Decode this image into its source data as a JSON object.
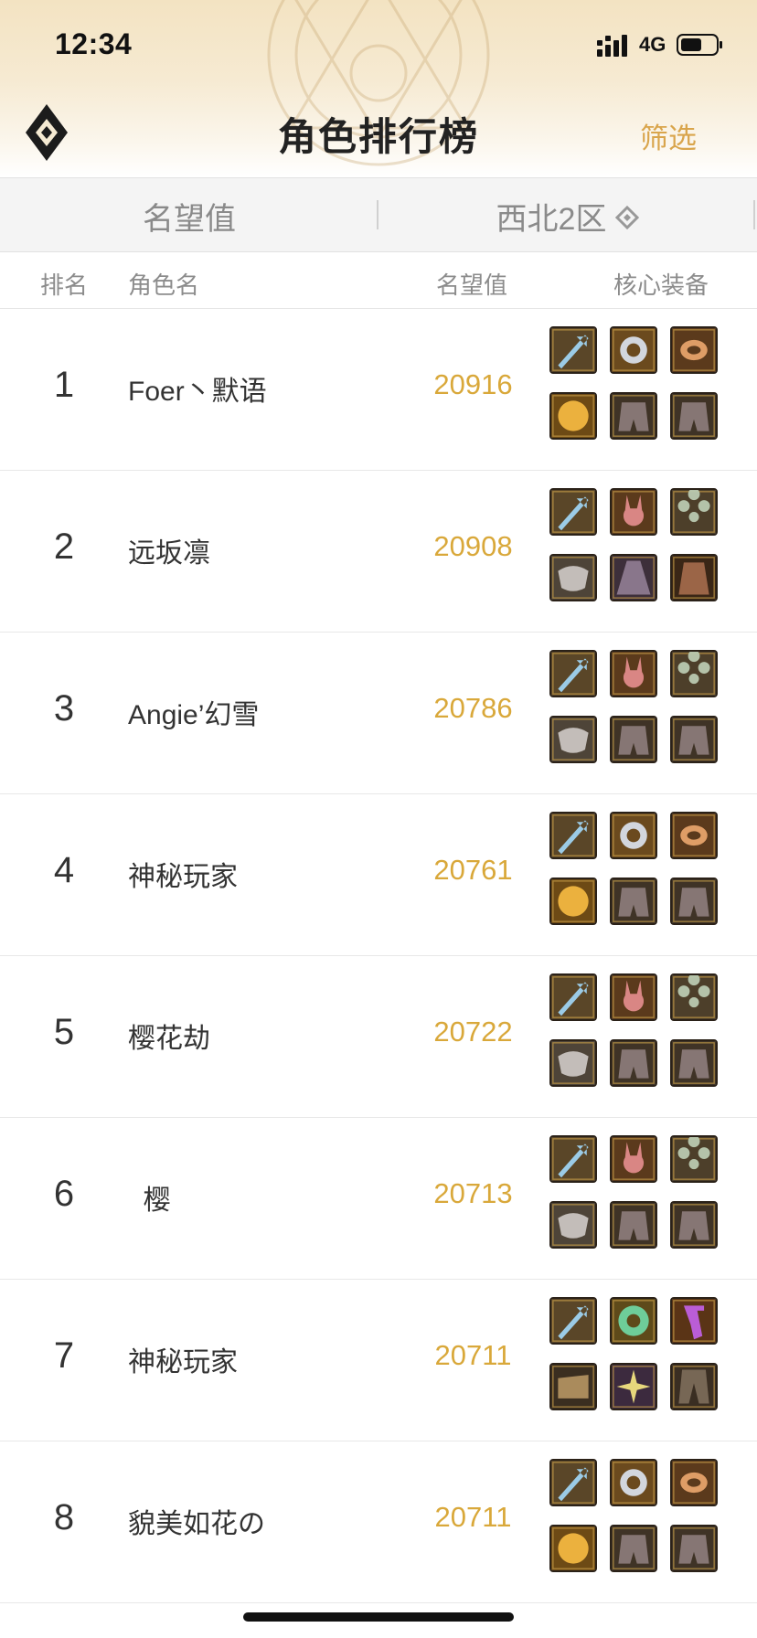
{
  "status_bar": {
    "time": "12:34",
    "network": "4G"
  },
  "header": {
    "title": "角色排行榜",
    "filter_label": "筛选"
  },
  "filter_bar": {
    "metric": "名望值",
    "server": "西北2区"
  },
  "columns": {
    "rank": "排名",
    "name": "角色名",
    "score": "名望值",
    "equipment": "核心装备"
  },
  "colors": {
    "accent": "#d9a83a",
    "filter_text": "#d9a54c",
    "header_bg": "#f3e3c2"
  },
  "rows": [
    {
      "rank": "1",
      "name": "Foer丶默语",
      "score": "20916",
      "equipment": [
        "sword-icon",
        "ring-icon",
        "bracelet-icon",
        "gem-icon",
        "armor-icon",
        "armor-icon"
      ]
    },
    {
      "rank": "2",
      "name": "远坂凛",
      "score": "20908",
      "equipment": [
        "sword-icon",
        "rabbit-icon",
        "clover-icon",
        "mask-icon",
        "cloak-icon",
        "coat-icon"
      ]
    },
    {
      "rank": "3",
      "name": "Angie’幻雪",
      "score": "20786",
      "equipment": [
        "sword-icon",
        "rabbit-icon",
        "clover-icon",
        "mask-icon",
        "armor-icon",
        "armor-icon"
      ]
    },
    {
      "rank": "4",
      "name": "神秘玩家",
      "score": "20761",
      "equipment": [
        "sword-icon",
        "ring-icon",
        "bracelet-icon",
        "gem-icon",
        "armor-icon",
        "armor-icon"
      ]
    },
    {
      "rank": "5",
      "name": "樱花劫",
      "score": "20722",
      "equipment": [
        "sword-icon",
        "rabbit-icon",
        "clover-icon",
        "mask-icon",
        "armor-icon",
        "armor-icon"
      ]
    },
    {
      "rank": "6",
      "name": "  樱",
      "score": "20713",
      "equipment": [
        "sword-icon",
        "rabbit-icon",
        "clover-icon",
        "mask-icon",
        "armor-icon",
        "armor-icon"
      ]
    },
    {
      "rank": "7",
      "name": "神秘玩家",
      "score": "20711",
      "equipment": [
        "sword-icon",
        "orb-ring-icon",
        "amulet-icon",
        "bracer-icon",
        "spark-icon",
        "pants-icon"
      ]
    },
    {
      "rank": "8",
      "name": "貌美如花の",
      "score": "20711",
      "equipment": [
        "sword-icon",
        "ring-icon",
        "bracelet-icon",
        "gem-icon",
        "armor-icon",
        "armor-icon"
      ]
    }
  ]
}
